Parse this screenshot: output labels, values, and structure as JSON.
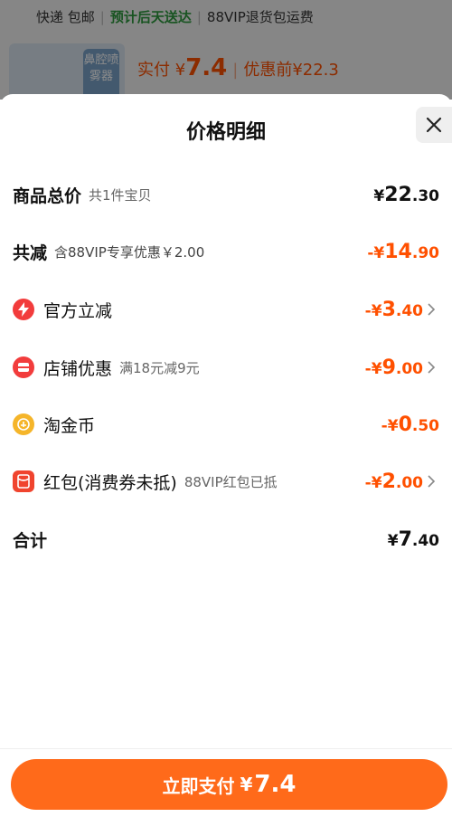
{
  "background": {
    "shipping": "快递 包邮",
    "delivery": "预计后天送达",
    "return": "88VIP退货包运费",
    "product_tag": "鼻腔喷雾器",
    "paid_label": "实付",
    "paid_currency": "¥",
    "paid_amount": "7.4",
    "before_label": "优惠前",
    "before_amount": "¥22.3"
  },
  "sheet": {
    "title": "价格明细",
    "close_icon": "close-icon"
  },
  "rows": {
    "total": {
      "label": "商品总价",
      "sub": "共1件宝贝",
      "currency": "¥",
      "int": "22",
      "dec": ".30"
    },
    "discount": {
      "label": "共减",
      "sub": "含88VIP专享优惠￥2.00",
      "prefix": "-¥",
      "int": "14",
      "dec": ".90"
    },
    "official": {
      "label": "官方立减",
      "icon": "lightning-icon",
      "prefix": "-¥",
      "int": "3",
      "dec": ".40"
    },
    "store": {
      "label": "店铺优惠",
      "sub": "满18元减9元",
      "icon": "store-coupon-icon",
      "prefix": "-¥",
      "int": "9",
      "dec": ".00"
    },
    "coins": {
      "label": "淘金币",
      "icon": "coin-icon",
      "prefix": "-¥",
      "int": "0",
      "dec": ".50"
    },
    "redpacket": {
      "label": "红包(消费券未抵)",
      "sub": "88VIP红包已抵",
      "icon": "red-packet-icon",
      "prefix": "-¥",
      "int": "2",
      "dec": ".00"
    },
    "sum": {
      "label": "合计",
      "currency": "¥",
      "int": "7",
      "dec": ".40"
    }
  },
  "footer": {
    "pay_label": "立即支付",
    "pay_currency": "¥",
    "pay_amount": "7.4"
  },
  "colors": {
    "accent": "#ff5000",
    "button": "#ff6a1a",
    "green": "#2e9a3e"
  }
}
